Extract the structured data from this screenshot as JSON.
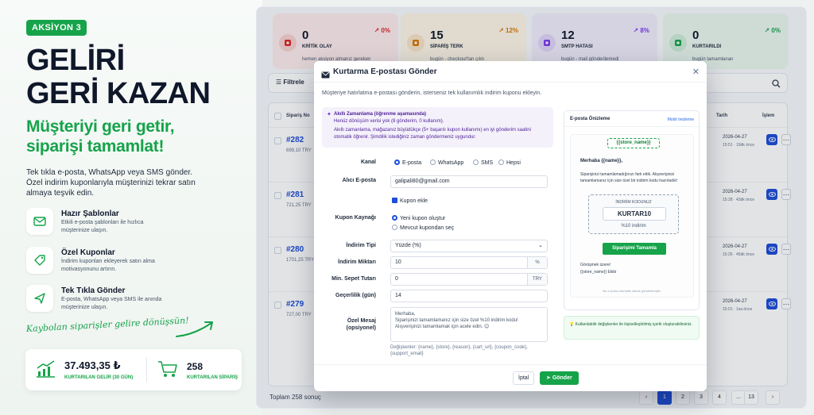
{
  "promo": {
    "badge": "AKSİYON 3",
    "headline_1": "GELİRİ",
    "headline_2": "GERİ KAZAN",
    "sub_1": "Müşteriyi geri getir,",
    "sub_2": "siparişi tamamlat!",
    "lead": "Tek tıkla e-posta, WhatsApp veya SMS gönder. Özel indirim kuponlarıyla müşterinizi tekrar satın almaya teşvik edin.",
    "features": [
      {
        "icon": "mail-icon",
        "title": "Hazır Şablonlar",
        "desc": "Etkili e-posta şablonları ile hızlıca müşterinize ulaşın."
      },
      {
        "icon": "coupon-icon",
        "title": "Özel Kuponlar",
        "desc": "İndirim kuponları ekleyerek satın alma motivasyonunu artırın."
      },
      {
        "icon": "send-icon",
        "title": "Tek Tıkla Gönder",
        "desc": "E-posta, WhatsApp veya SMS ile anında müşterinize ulaşın."
      }
    ],
    "slogan": "Kaybolan siparişler gelire dönüşsün!",
    "stat_revenue": "37.493,35 ₺",
    "stat_revenue_label": "KURTARILAN GELİR (30 GÜN)",
    "stat_orders": "258",
    "stat_orders_label": "KURTARILAN SİPARİŞ"
  },
  "kpis": [
    {
      "value": "0",
      "label": "KRİTİK OLAY",
      "sub": "hemen aksiyon almanız gereken",
      "pct": "↗ 0%",
      "bg": "#fdecec",
      "accent": "#dc2626"
    },
    {
      "value": "15",
      "label": "SİPARİŞ TERK",
      "sub": "bugün - checkout'tan çıktı",
      "pct": "↗ 12%",
      "bg": "#fdf5e6",
      "accent": "#d97706"
    },
    {
      "value": "12",
      "label": "SMTP HATASI",
      "sub": "bugün - mail gönderilemedi",
      "pct": "↗ 8%",
      "bg": "#f1edfb",
      "accent": "#7c3aed"
    },
    {
      "value": "0",
      "label": "KURTARILDI",
      "sub": "bugün tamamlanan",
      "pct": "↗ 0%",
      "bg": "#eaf7ee",
      "accent": "#16a34a"
    }
  ],
  "filter_label": "Filtrele",
  "table": {
    "col_order": "Sipariş No",
    "col_date": "Tarih",
    "col_action": "İşlem",
    "rows": [
      {
        "id": "#282",
        "amount": "699,10 TRY",
        "date": "2026-04-27",
        "ago": "15:51 · 19dk önce"
      },
      {
        "id": "#281",
        "amount": "721,25 TRY",
        "date": "2026-04-27",
        "ago": "15:28 · 43dk önce"
      },
      {
        "id": "#280",
        "amount": "1701,25 TRY",
        "date": "2026-04-27",
        "ago": "15:26 · 45dk önce"
      },
      {
        "id": "#279",
        "amount": "727,00 TRY",
        "date": "2026-04-27",
        "ago": "15:01 · 1sa önce"
      }
    ]
  },
  "total": "Toplam 258 sonuç",
  "pagination": [
    "‹",
    "1",
    "2",
    "3",
    "4",
    "...",
    "13",
    "›"
  ],
  "modal": {
    "title": "Kurtarma E-postası Gönder",
    "desc": "Müşteriye hatırlatma e-postası gönderin, isterseniz tek kullanımlık indirim kuponu ekleyin.",
    "smart_title": "Akıllı Zamanlama (öğrenme aşamasında)",
    "smart_line": "Henüz dönüşüm verisi yok (8 gönderim, 0 kullanım).",
    "smart_text": "Akıllı zamanlama, mağazanız büyüdükçe (5+ başarılı kupon kullanımı) en iyi gönderim saatini otomatik öğrenir. Şimdilik istediğiniz zaman göndermeniz uygundur.",
    "channel_label": "Kanal",
    "channels": [
      "E-posta",
      "WhatsApp",
      "SMS",
      "Hepsi"
    ],
    "recipient_label": "Alıcı E-posta",
    "recipient_value": "galipali80@gmail.com",
    "add_coupon": "Kupon ekle",
    "coupon_source_label": "Kupon Kaynağı",
    "coupon_source_new": "Yeni kupon oluştur",
    "coupon_source_existing": "Mevcut kupondan seç",
    "discount_type_label": "İndirim Tipi",
    "discount_type_value": "Yüzde (%)",
    "discount_amount_label": "İndirim Miktarı",
    "discount_amount_value": "10",
    "discount_amount_suffix": "%",
    "min_cart_label": "Min. Sepet Tutarı",
    "min_cart_value": "0",
    "min_cart_suffix": "TRY",
    "validity_label": "Geçerlilik (gün)",
    "validity_value": "14",
    "message_label": "Özel Mesaj (opsiyonel)",
    "message_value": "Merhaba,\nSiparişinizi tamamlamanız için size özel %10 indirim kodu! Alışverişinizi tamamlamak için acele edin. 😊",
    "vars": "Değişkenler: {name}, {store}, {reason}, {cart_url}, {coupon_code}, {support_email}",
    "cancel": "İptal",
    "send": "Gönder",
    "preview_title": "E-posta Önizleme",
    "preview_mobile": "Mobil önizleme",
    "preview_store": "{{store_name}}",
    "preview_greeting": "Merhaba {{name}},",
    "preview_text": "Siparişinizi tamamlamadığınızı fark ettik. Alışverişinizi tamamlamanız için size özel bir indirim kodu hazırladık!",
    "coupon_label": "İNDİRİM KODUNUZ",
    "coupon_code": "KURTAR10",
    "coupon_pct": "%10 indirim",
    "preview_button": "Siparişimi Tamamla",
    "preview_sign_1": "Görüşmek üzere!",
    "preview_sign_2": "{{store_name}} Ekibi",
    "preview_footer": "Bu e-posta otomatik olarak gönderilmiştir.",
    "hint": "Kullanılabilir değişkenler ile kişiselleştirilmiş içerik oluşturabilirsiniz."
  }
}
